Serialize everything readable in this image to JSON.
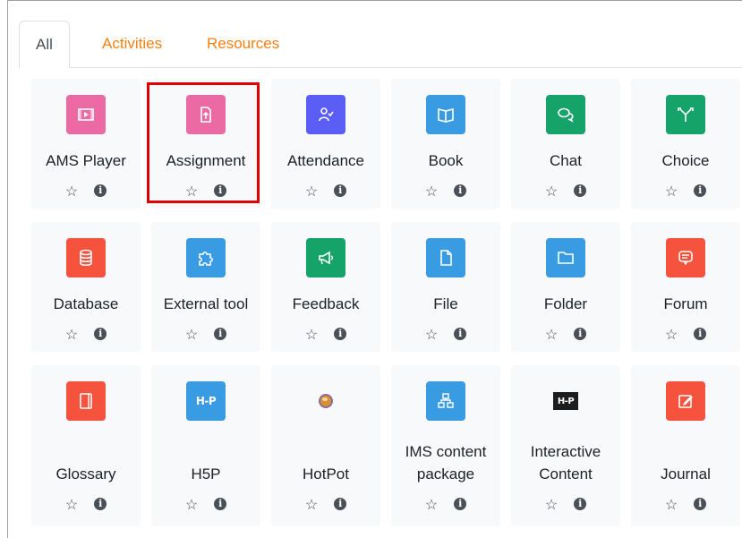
{
  "tabs": {
    "all": "All",
    "activities": "Activities",
    "resources": "Resources"
  },
  "colors": {
    "pink": "#ec6aa4",
    "purple": "#5b5ef5",
    "blue": "#399be2",
    "green": "#16a36a",
    "red": "#f5533d",
    "accent": "#f98012",
    "highlight": "#e00000"
  },
  "modules": [
    {
      "name": "AMS Player",
      "icon": "video-icon"
    },
    {
      "name": "Assignment",
      "icon": "upload-file-icon"
    },
    {
      "name": "Attendance",
      "icon": "people-icon"
    },
    {
      "name": "Book",
      "icon": "book-icon"
    },
    {
      "name": "Chat",
      "icon": "chat-icon"
    },
    {
      "name": "Choice",
      "icon": "choice-icon"
    },
    {
      "name": "Database",
      "icon": "database-icon"
    },
    {
      "name": "External tool",
      "icon": "puzzle-icon"
    },
    {
      "name": "Feedback",
      "icon": "megaphone-icon"
    },
    {
      "name": "File",
      "icon": "file-icon"
    },
    {
      "name": "Folder",
      "icon": "folder-icon"
    },
    {
      "name": "Forum",
      "icon": "forum-icon"
    },
    {
      "name": "Glossary",
      "icon": "glossary-icon"
    },
    {
      "name": "H5P",
      "icon": "h5p-icon",
      "label": "H-P"
    },
    {
      "name": "HotPot",
      "icon": "hotpot-icon"
    },
    {
      "name": "IMS content package",
      "name_line1": "IMS content",
      "name_line2": "package",
      "icon": "package-icon"
    },
    {
      "name": "Interactive Content",
      "name_line1": "Interactive",
      "name_line2": "Content",
      "icon": "interactive-content-icon",
      "label": "H-P"
    },
    {
      "name": "Journal",
      "icon": "journal-icon"
    }
  ],
  "star_glyph": "☆",
  "info_glyph": "i"
}
